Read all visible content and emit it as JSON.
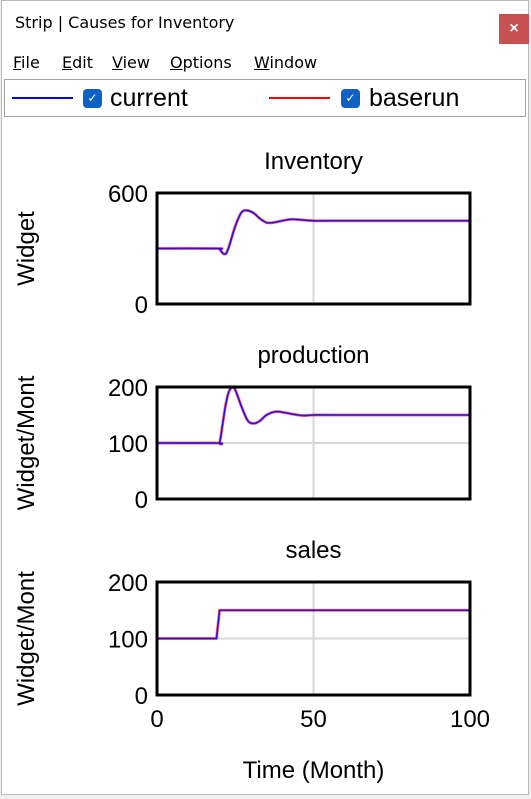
{
  "window": {
    "title": "Strip | Causes for Inventory",
    "close_label": "×"
  },
  "menu": [
    {
      "accel": "F",
      "rest": "ile"
    },
    {
      "accel": "E",
      "rest": "dit"
    },
    {
      "accel": "V",
      "rest": "iew"
    },
    {
      "accel": "O",
      "rest": "ptions"
    },
    {
      "accel": "W",
      "rest": "indow"
    }
  ],
  "legend": [
    {
      "label": "current",
      "color": "#0000ff",
      "checked": true,
      "check_glyph": "✓"
    },
    {
      "label": "baserun",
      "color": "#ff0000",
      "checked": true,
      "check_glyph": "✓"
    }
  ],
  "colors": {
    "overlap": "#7030d8",
    "grid": "#d8d8d8",
    "close_bg": "#c75050",
    "checkbox_bg": "#0f62c5"
  },
  "chart_data": [
    {
      "type": "line",
      "title": "Inventory",
      "xlabel": "",
      "ylabel": "Widget",
      "xlim": [
        0,
        100
      ],
      "ylim": [
        0,
        600
      ],
      "yticks": [
        "0",
        "600"
      ],
      "grid": true,
      "x": [
        0,
        19,
        20,
        21,
        22,
        23,
        25,
        27,
        29,
        31,
        33,
        35,
        37,
        40,
        43,
        46,
        50,
        55,
        60,
        100
      ],
      "series": [
        {
          "name": "current",
          "values": [
            300,
            300,
            295,
            275,
            272,
            310,
            420,
            495,
            505,
            490,
            460,
            440,
            440,
            450,
            458,
            455,
            450,
            450,
            450,
            450
          ]
        },
        {
          "name": "baserun",
          "values": [
            300,
            300,
            295,
            275,
            272,
            310,
            420,
            495,
            505,
            490,
            460,
            440,
            440,
            450,
            458,
            455,
            450,
            450,
            450,
            450
          ]
        }
      ]
    },
    {
      "type": "line",
      "title": "production",
      "xlabel": "",
      "ylabel": "Widget/Month",
      "ylabel_visible": "Widget/Mont",
      "xlim": [
        0,
        100
      ],
      "ylim": [
        0,
        200
      ],
      "yticks": [
        "0",
        "100",
        "200"
      ],
      "grid": true,
      "x": [
        0,
        19,
        20,
        21,
        22,
        23,
        24,
        25,
        27,
        29,
        31,
        33,
        35,
        38,
        41,
        44,
        47,
        50,
        55,
        60,
        100
      ],
      "series": [
        {
          "name": "current",
          "values": [
            100,
            100,
            101,
            135,
            170,
            192,
            199,
            195,
            165,
            140,
            135,
            140,
            150,
            156,
            154,
            151,
            149,
            150,
            150,
            150,
            150
          ]
        },
        {
          "name": "baserun",
          "values": [
            100,
            100,
            101,
            135,
            170,
            192,
            199,
            195,
            165,
            140,
            135,
            140,
            150,
            156,
            154,
            151,
            149,
            150,
            150,
            150,
            150
          ]
        }
      ]
    },
    {
      "type": "line",
      "title": "sales",
      "xlabel": "Time (Month)",
      "ylabel": "Widget/Month",
      "ylabel_visible": "Widget/Mont",
      "xlim": [
        0,
        100
      ],
      "ylim": [
        0,
        200
      ],
      "yticks": [
        "0",
        "100",
        "200"
      ],
      "xticks": [
        "0",
        "50",
        "100"
      ],
      "grid": true,
      "x": [
        0,
        19,
        20,
        100
      ],
      "series": [
        {
          "name": "current",
          "values": [
            100,
            100,
            150,
            150
          ]
        },
        {
          "name": "baserun",
          "values": [
            100,
            100,
            150,
            150
          ]
        }
      ]
    }
  ]
}
